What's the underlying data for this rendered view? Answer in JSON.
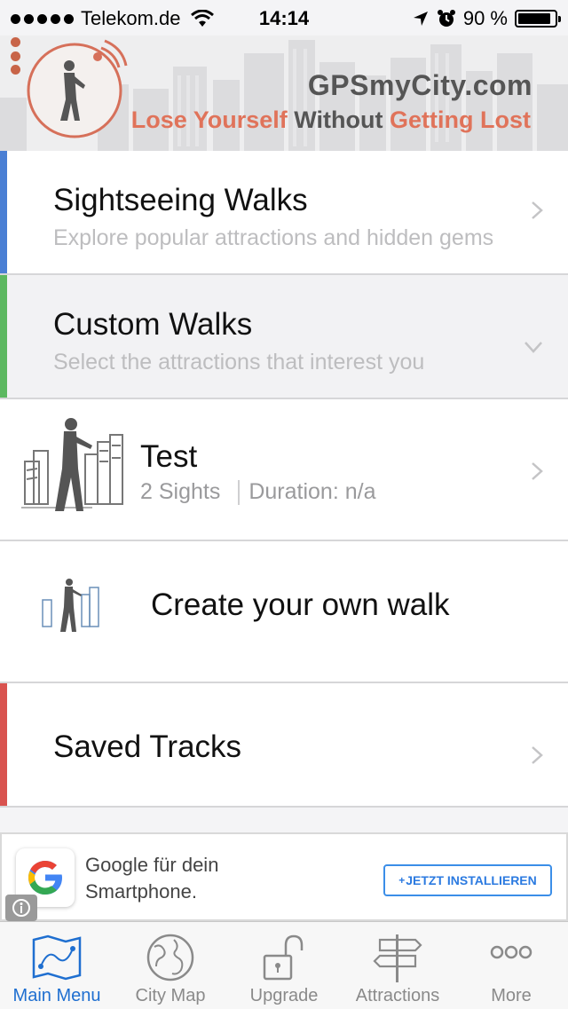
{
  "status_bar": {
    "carrier": "Telekom.de",
    "time": "14:14",
    "battery_percent": "90 %",
    "battery_level": 0.9
  },
  "header": {
    "site": "GPSmyCity.com",
    "tagline_1": "Lose Yourself",
    "tagline_2": "Without",
    "tagline_3": "Getting Lost"
  },
  "menu": {
    "sightseeing": {
      "title": "Sightseeing Walks",
      "subtitle": "Explore popular attractions and hidden gems",
      "accent": "#4a7fd4"
    },
    "custom": {
      "title": "Custom Walks",
      "subtitle": "Select the attractions that interest you",
      "accent": "#5cb860"
    },
    "walk": {
      "title": "Test",
      "sights": "2 Sights",
      "duration": "Duration: n/a"
    },
    "create": {
      "title": "Create your own walk"
    },
    "saved": {
      "title": "Saved Tracks",
      "accent": "#d9534f"
    }
  },
  "ad": {
    "line1": "Google für dein",
    "line2": "Smartphone.",
    "button": "JETZT INSTALLIEREN"
  },
  "tabs": [
    {
      "label": "Main Menu",
      "icon": "map-icon",
      "active": true
    },
    {
      "label": "City Map",
      "icon": "globe-icon",
      "active": false
    },
    {
      "label": "Upgrade",
      "icon": "unlock-icon",
      "active": false
    },
    {
      "label": "Attractions",
      "icon": "signpost-icon",
      "active": false
    },
    {
      "label": "More",
      "icon": "more-icon",
      "active": false
    }
  ]
}
